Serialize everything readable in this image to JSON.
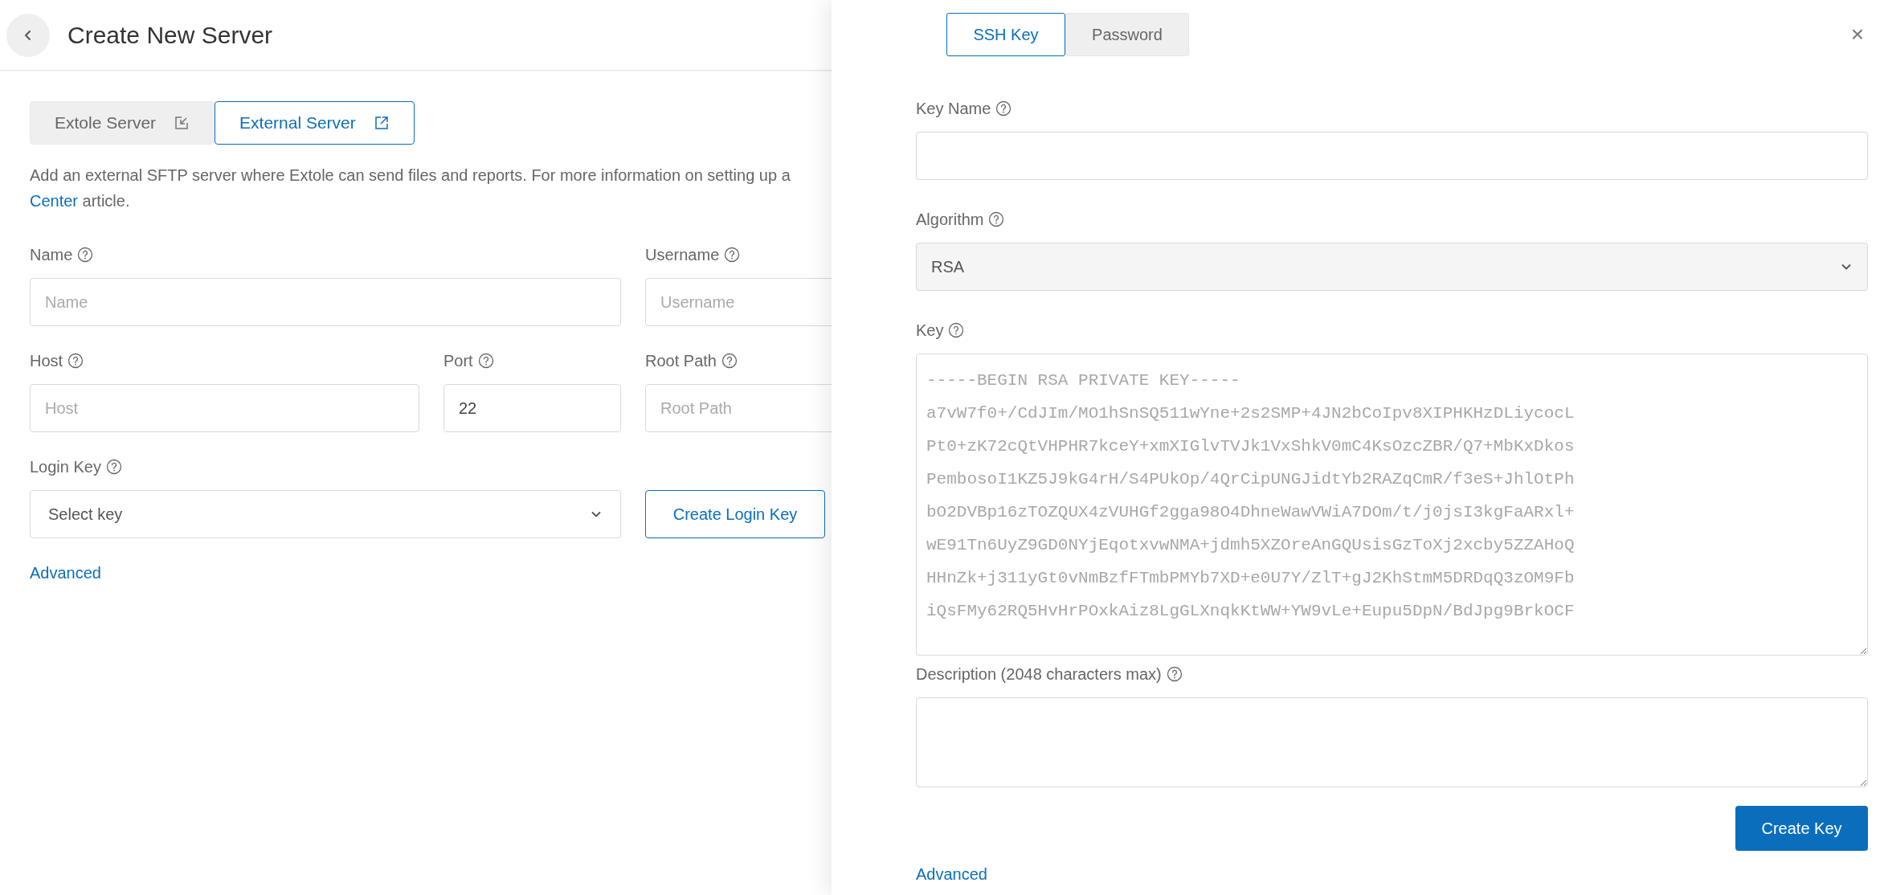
{
  "page": {
    "title": "Create New Server"
  },
  "server_tabs": [
    {
      "label": "Extole Server",
      "kind": "internal",
      "selected": false
    },
    {
      "label": "External Server",
      "kind": "external",
      "selected": true
    }
  ],
  "description": {
    "line_1": "Add an external SFTP server where Extole can send files and reports. For more information on setting up a",
    "link": "Center",
    "line_2_rest": " article."
  },
  "fields": {
    "name": {
      "label": "Name",
      "placeholder": "Name"
    },
    "username": {
      "label": "Username",
      "placeholder": "Username"
    },
    "host": {
      "label": "Host",
      "placeholder": "Host"
    },
    "port": {
      "label": "Port",
      "value": "22"
    },
    "root_path": {
      "label": "Root Path",
      "placeholder": "Root Path"
    },
    "login_key": {
      "label": "Login Key",
      "value": "Select key"
    }
  },
  "create_login_key_button": "Create Login Key",
  "advanced_link": "Advanced",
  "drawer": {
    "auth_tabs": [
      {
        "label": "SSH Key",
        "selected": true
      },
      {
        "label": "Password",
        "selected": false
      }
    ],
    "close": "×",
    "key_name": {
      "label": "Key Name"
    },
    "algorithm": {
      "label": "Algorithm",
      "value": "RSA"
    },
    "key": {
      "label": "Key",
      "placeholder": "-----BEGIN RSA PRIVATE KEY-----\na7vW7f0+/CdJIm/MO1hSnSQ511wYne+2s2SMP+4JN2bCoIpv8XIPHKHzDLiycocL\nPt0+zK72cQtVHPHR7kceY+xmXIGlvTVJk1VxShkV0mC4KsOzcZBR/Q7+MbKxDkos\nPembosoI1KZ5J9kG4rH/S4PUkOp/4QrCipUNGJidtYb2RAZqCmR/f3eS+JhlOtPh\nbO2DVBp16zTOZQUX4zVUHGf2gga98O4DhneWawVWiA7DOm/t/j0jsI3kgFaARxl+\nwE91Tn6UyZ9GD0NYjEqotxvwNMA+jdmh5XZOreAnGQUsisGzToXj2xcby5ZZAHoQ\nHHnZk+j311yGt0vNmBzfFTmbPMYb7XD+e0U7Y/ZlT+gJ2KhStmM5DRDqQ3zOM9Fb\niQsFMy62RQ5HvHrPOxkAiz8LgGLXnqkKtWW+YW9vLe+Eupu5DpN/BdJpg9BrkOCF"
    },
    "description_field": {
      "label": "Description (2048 characters max)"
    },
    "create_key_button": "Create Key",
    "advanced_link": "Advanced"
  }
}
